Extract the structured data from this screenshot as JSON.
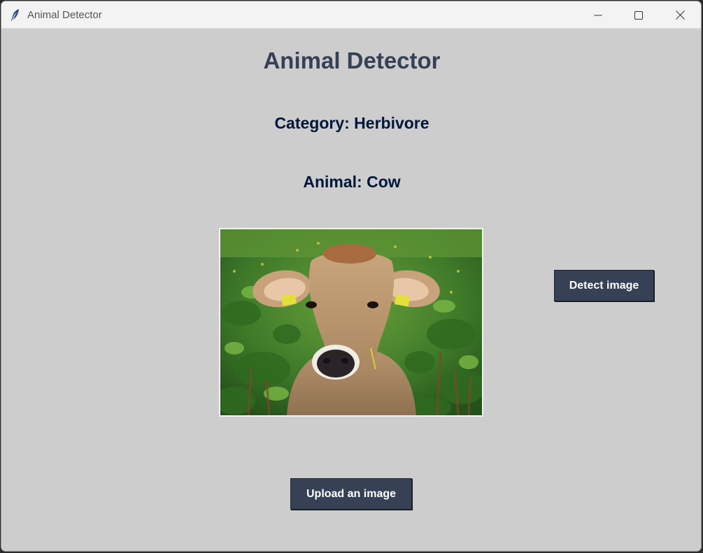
{
  "window": {
    "title": "Animal Detector",
    "icon": "feather-icon"
  },
  "controls": {
    "minimize_icon": "minimize-icon",
    "maximize_icon": "maximize-icon",
    "close_icon": "close-icon"
  },
  "main": {
    "heading": "Animal Detector",
    "category": "Category: Herbivore",
    "animal": "Animal: Cow",
    "image_subject": "cow in a green field"
  },
  "buttons": {
    "detect_label": "Detect image",
    "upload_label": "Upload an image"
  },
  "colors": {
    "background": "#cdcdcd",
    "heading": "#364156",
    "label": "#011638",
    "button_bg": "#364156",
    "button_text": "#ffffff"
  }
}
